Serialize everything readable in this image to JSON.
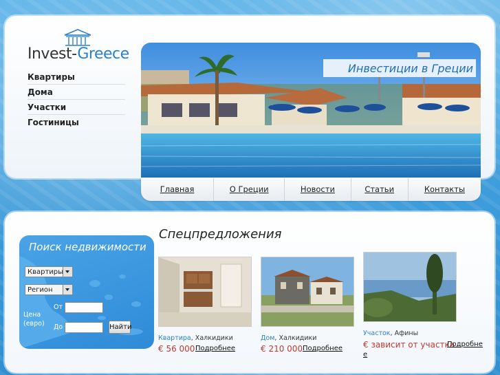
{
  "header": {
    "logo_part1": "Invest-",
    "logo_part2": "Greece",
    "hero_title": "Инвестиции в Греции"
  },
  "left_nav": [
    "Квартиры",
    "Дома",
    "Участки",
    "Гостиницы"
  ],
  "top_nav": [
    "Главная",
    "О Греции",
    "Новости",
    "Статьи",
    "Контакты"
  ],
  "search": {
    "title": "Поиск недвижимости",
    "type_select": "Квартиры",
    "region_select": "Регион",
    "price_label_1": "Цена",
    "price_label_2": "(евро)",
    "from_label": "От",
    "to_label": "До",
    "button": "Найти"
  },
  "specials": {
    "title": "Спецпредложения",
    "items": [
      {
        "type": "Квартира",
        "location": ", Халкидики",
        "price": "€ 56 000",
        "more": "Подробнее"
      },
      {
        "type": "Дом",
        "location": ", Халкидики",
        "price": "€ 210 000",
        "more": "Подробнее"
      },
      {
        "type": "Участок",
        "location": ", Афины",
        "price": "€ зависит от участка",
        "more_1": "Подробне",
        "more_2": "е"
      }
    ]
  },
  "colors": {
    "accent": "#2a7fc7",
    "price": "#c0392b",
    "background_water": "#3f9ddb"
  }
}
